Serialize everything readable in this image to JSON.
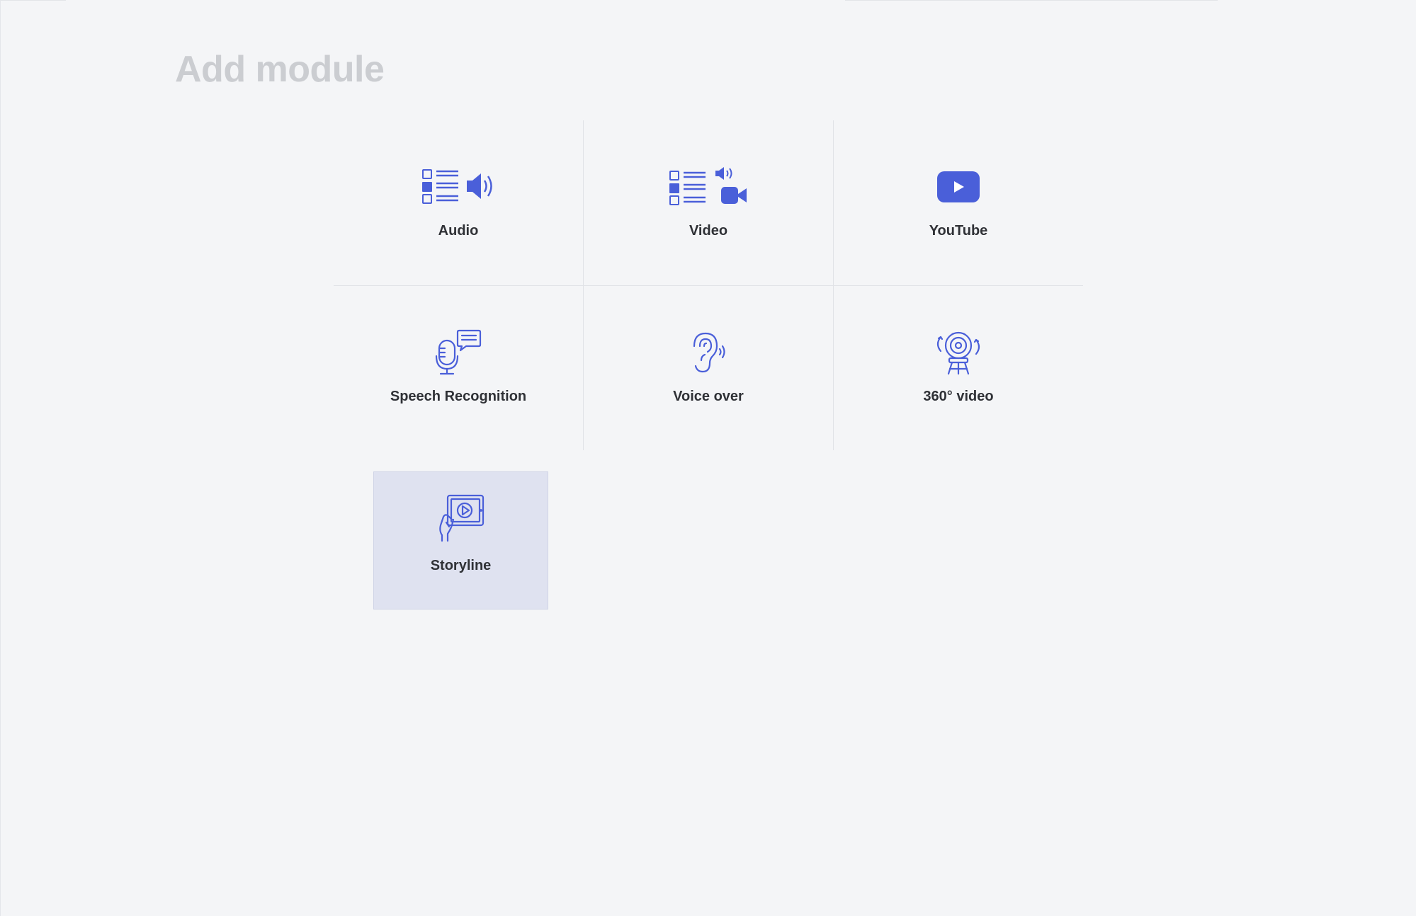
{
  "page": {
    "title": "Add module"
  },
  "colors": {
    "accent": "#4a5fd9",
    "background": "#f4f5f7",
    "title": "#cbcdd1",
    "selected_tile": "#dfe2f0"
  },
  "modules": [
    {
      "label": "Audio",
      "icon": "audio-list-icon"
    },
    {
      "label": "Video",
      "icon": "video-list-icon"
    },
    {
      "label": "YouTube",
      "icon": "youtube-icon"
    },
    {
      "label": "Speech Recognition",
      "icon": "microphone-speech-icon"
    },
    {
      "label": "Voice over",
      "icon": "ear-sound-icon"
    },
    {
      "label": "360° video",
      "icon": "360-camera-icon"
    },
    {
      "label": "Storyline",
      "icon": "tablet-play-icon",
      "selected": true
    }
  ]
}
